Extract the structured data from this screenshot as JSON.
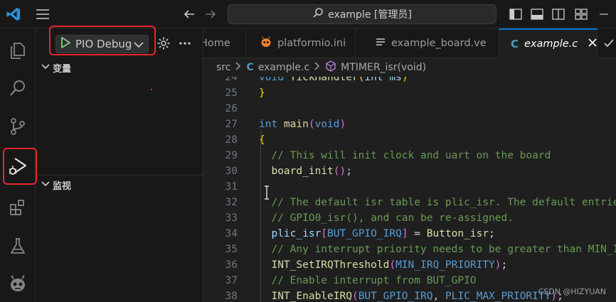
{
  "window": {
    "search_text": "example [管理员]"
  },
  "sidebar": {
    "config_label": "PIO Debug",
    "variables_header": "变量",
    "watch_header": "监视"
  },
  "tabs": [
    {
      "label": "Home"
    },
    {
      "label": "platformio.ini"
    },
    {
      "label": "example_board.ve"
    },
    {
      "label": "example.c"
    }
  ],
  "breadcrumb": {
    "folder": "src",
    "file": "example.c",
    "symbol": "MTIMER_isr(void)"
  },
  "editor": {
    "lines": [
      {
        "num": "24",
        "segs": [
          {
            "t": "void ",
            "c": "#569cd6"
          },
          {
            "t": "TickHandler",
            "c": "#dcdcaa"
          },
          {
            "t": "(",
            "c": "#ffd700"
          },
          {
            "t": "int ms",
            "c": "#9cdcfe"
          },
          {
            "t": ")",
            "c": "#ffd700"
          }
        ]
      },
      {
        "num": "25",
        "segs": [
          {
            "t": "}",
            "c": "#ffd700"
          }
        ]
      },
      {
        "num": "26",
        "segs": []
      },
      {
        "num": "27",
        "segs": [
          {
            "t": "int ",
            "c": "#569cd6"
          },
          {
            "t": "main",
            "c": "#dcdcaa"
          },
          {
            "t": "(",
            "c": "#da70d6"
          },
          {
            "t": "void",
            "c": "#569cd6"
          },
          {
            "t": ")",
            "c": "#da70d6"
          }
        ]
      },
      {
        "num": "28",
        "segs": [
          {
            "t": "{",
            "c": "#ffd700"
          }
        ]
      },
      {
        "num": "29",
        "segs": [
          {
            "t": "  // This will init clock and uart on the board",
            "c": "#6a9955"
          }
        ]
      },
      {
        "num": "30",
        "segs": [
          {
            "t": "  ",
            "c": "#d4d4d4"
          },
          {
            "t": "board_init",
            "c": "#dcdcaa"
          },
          {
            "t": "()",
            "c": "#da70d6"
          },
          {
            "t": ";",
            "c": "#d4d4d4"
          }
        ]
      },
      {
        "num": "31",
        "segs": []
      },
      {
        "num": "32",
        "segs": [
          {
            "t": "  // The default isr table is plic_isr. The default entries are",
            "c": "#6a9955"
          }
        ]
      },
      {
        "num": "33",
        "segs": [
          {
            "t": "  // GPIO0_isr(), and can be re-assigned.",
            "c": "#6a9955"
          }
        ]
      },
      {
        "num": "34",
        "segs": [
          {
            "t": "  ",
            "c": "#d4d4d4"
          },
          {
            "t": "plic_isr",
            "c": "#9cdcfe"
          },
          {
            "t": "[",
            "c": "#da70d6"
          },
          {
            "t": "BUT_GPIO_IRQ",
            "c": "#569cd6"
          },
          {
            "t": "]",
            "c": "#da70d6"
          },
          {
            "t": " = ",
            "c": "#d4d4d4"
          },
          {
            "t": "Button_isr",
            "c": "#dcdcaa"
          },
          {
            "t": ";",
            "c": "#d4d4d4"
          }
        ]
      },
      {
        "num": "35",
        "segs": [
          {
            "t": "  // Any interrupt priority needs to be greater than MIN_IRQ_PRIORITY",
            "c": "#6a9955"
          }
        ]
      },
      {
        "num": "36",
        "segs": [
          {
            "t": "  ",
            "c": "#d4d4d4"
          },
          {
            "t": "INT_SetIRQThreshold",
            "c": "#dcdcaa"
          },
          {
            "t": "(",
            "c": "#da70d6"
          },
          {
            "t": "MIN_IRQ_PRIORITY",
            "c": "#569cd6"
          },
          {
            "t": ")",
            "c": "#da70d6"
          },
          {
            "t": ";",
            "c": "#d4d4d4"
          }
        ]
      },
      {
        "num": "37",
        "segs": [
          {
            "t": "  // Enable interrupt from BUT_GPIO",
            "c": "#6a9955"
          }
        ]
      },
      {
        "num": "38",
        "segs": [
          {
            "t": "  ",
            "c": "#d4d4d4"
          },
          {
            "t": "INT_EnableIRQ",
            "c": "#dcdcaa"
          },
          {
            "t": "(",
            "c": "#da70d6"
          },
          {
            "t": "BUT_GPIO_IRQ",
            "c": "#569cd6"
          },
          {
            "t": ", ",
            "c": "#d4d4d4"
          },
          {
            "t": "PLIC_MAX_PRIORITY",
            "c": "#569cd6"
          },
          {
            "t": ")",
            "c": "#da70d6"
          },
          {
            "t": ";",
            "c": "#d4d4d4"
          }
        ]
      }
    ]
  },
  "watermark": "CSDN @HIZYUAN",
  "colors": {
    "accent": "#0078d4",
    "annotation_red": "#e5262b",
    "run_green": "#89d185"
  }
}
